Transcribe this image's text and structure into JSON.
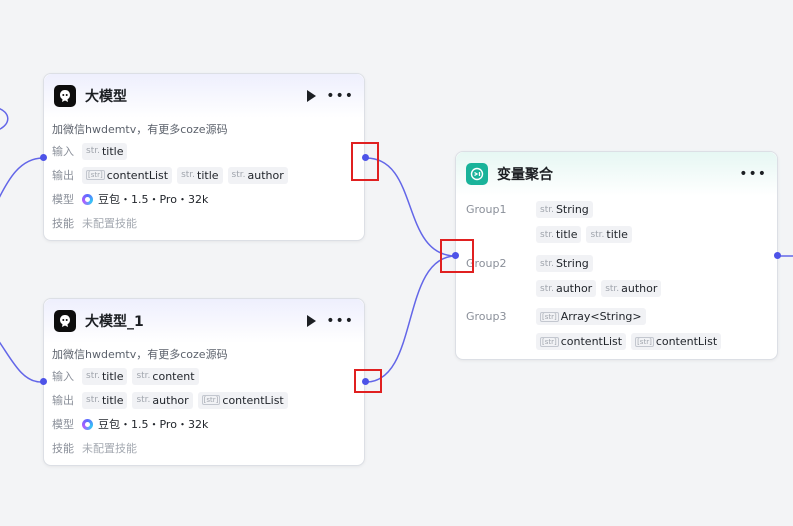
{
  "node1": {
    "title": "大模型",
    "description": "加微信hwdemtv，有更多coze源码",
    "input_label": "输入",
    "input_prefix": "str.",
    "input_value": "title",
    "output_label": "输出",
    "out1_prefix": "[str]",
    "out1_value": "contentList",
    "out2_prefix": "str.",
    "out2_value": "title",
    "out3_prefix": "str.",
    "out3_value": "author",
    "model_label": "模型",
    "model_value": "豆包・1.5・Pro・32k",
    "skill_label": "技能",
    "skill_value": "未配置技能"
  },
  "node2": {
    "title": "大模型_1",
    "description": "加微信hwdemtv，有更多coze源码",
    "input_label": "输入",
    "in1_prefix": "str.",
    "in1_value": "title",
    "in2_prefix": "str.",
    "in2_value": "content",
    "output_label": "输出",
    "out1_prefix": "str.",
    "out1_value": "title",
    "out2_prefix": "str.",
    "out2_value": "author",
    "out3_prefix": "[str]",
    "out3_value": "contentList",
    "model_label": "模型",
    "model_value": "豆包・1.5・Pro・32k",
    "skill_label": "技能",
    "skill_value": "未配置技能"
  },
  "aggregator": {
    "title": "变量聚合",
    "groups": [
      {
        "name": "Group1",
        "type_prefix": "str.",
        "type_value": "String",
        "vars": [
          {
            "prefix": "str.",
            "value": "title"
          },
          {
            "prefix": "str.",
            "value": "title"
          }
        ]
      },
      {
        "name": "Group2",
        "type_prefix": "str.",
        "type_value": "String",
        "vars": [
          {
            "prefix": "str.",
            "value": "author"
          },
          {
            "prefix": "str.",
            "value": "author"
          }
        ]
      },
      {
        "name": "Group3",
        "type_prefix": "[str]",
        "type_value": "Array<String>",
        "vars": [
          {
            "prefix": "[str]",
            "value": "contentList"
          },
          {
            "prefix": "[str]",
            "value": "contentList"
          }
        ]
      }
    ]
  },
  "colors": {
    "wire": "#6366e8",
    "handle": "#4d53e8",
    "highlight": "#e02020",
    "aggregator_icon": "#19b39a"
  }
}
